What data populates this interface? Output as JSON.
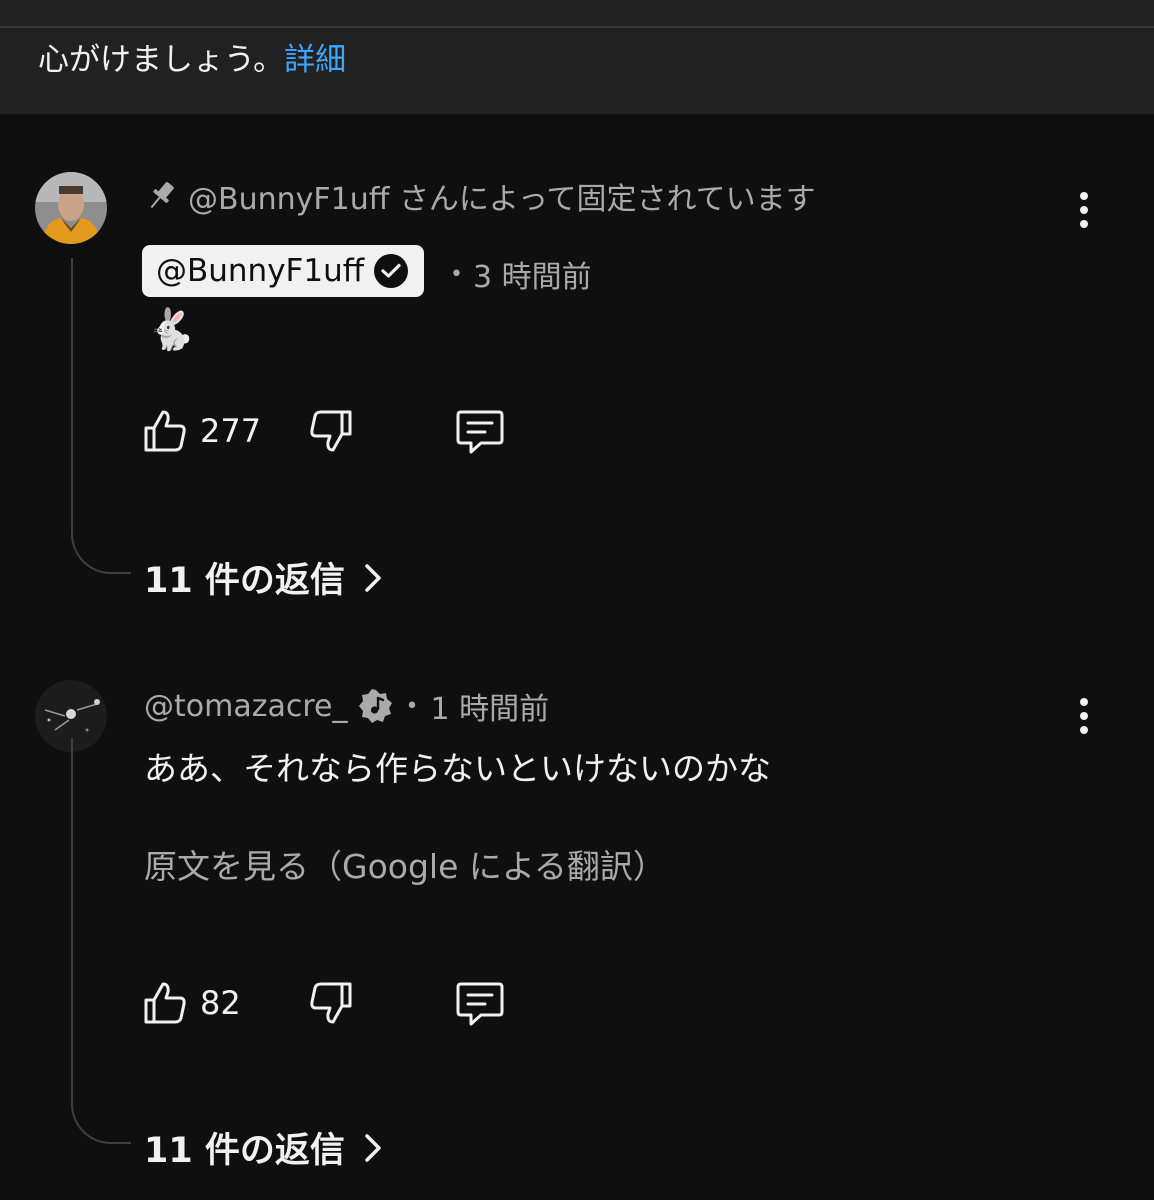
{
  "notice": {
    "text": "心がけましょう。",
    "link": "詳細"
  },
  "comments": [
    {
      "pinned_text": "@BunnyF1uff さんによって固定されています",
      "author": "@BunnyF1uff",
      "author_verified": true,
      "time": "3 時間前",
      "text": "🐇",
      "likes": "277",
      "replies_label": "11 件の返信"
    },
    {
      "author": "@tomazacre_",
      "author_badge": "music-note-badge",
      "time": "1 時間前",
      "text": "ああ、それなら作らないといけないのかな",
      "translate_link": "原文を見る（Google による翻訳）",
      "likes": "82",
      "replies_label": "11 件の返信"
    }
  ],
  "colors": {
    "background": "#0f0f0f",
    "notice_background": "#212121",
    "link": "#3ea6ff",
    "secondary_text": "#aaaaaa"
  }
}
